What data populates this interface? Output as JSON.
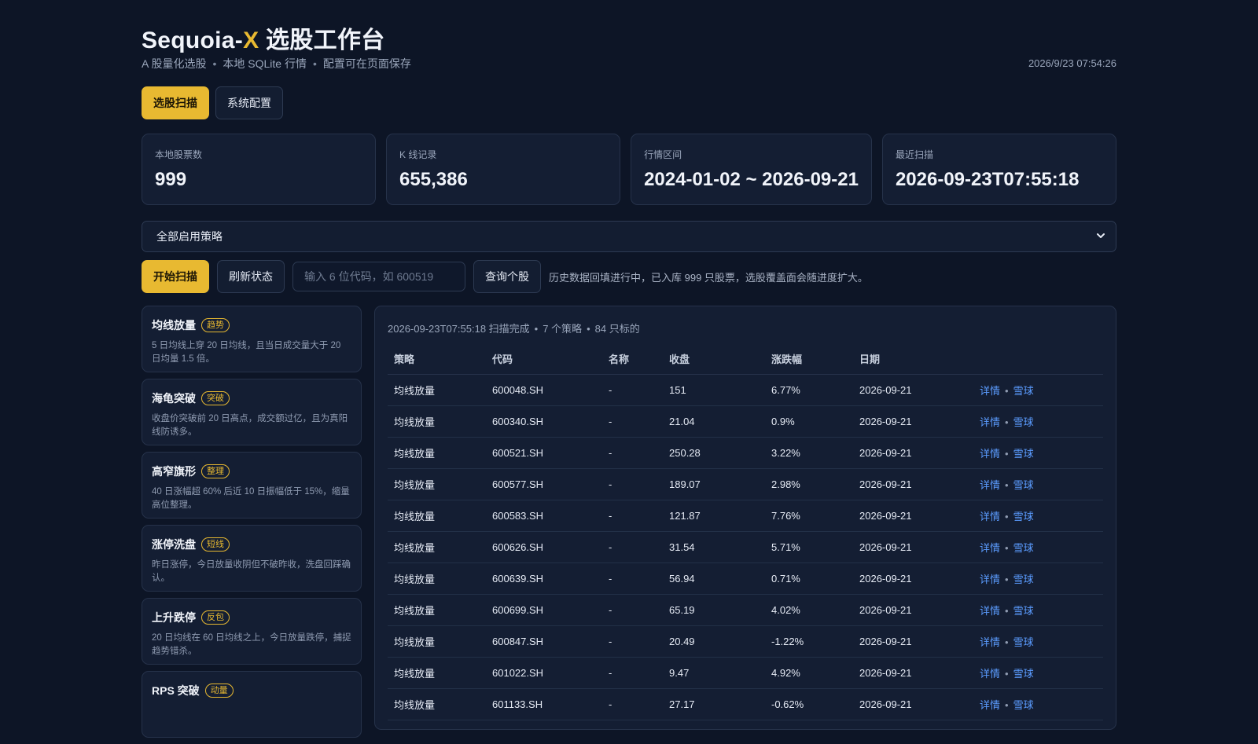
{
  "header": {
    "title_prefix": "Sequoia-",
    "title_accent": "X",
    "title_suffix": " 选股工作台",
    "subtitle_parts": [
      "A 股量化选股",
      "本地 SQLite 行情",
      "配置可在页面保存"
    ],
    "clock": "2026/9/23 07:54:26"
  },
  "tabs": [
    {
      "label": "选股扫描",
      "active": true
    },
    {
      "label": "系统配置",
      "active": false
    }
  ],
  "stats": [
    {
      "label": "本地股票数",
      "value": "999"
    },
    {
      "label": "K 线记录",
      "value": "655,386"
    },
    {
      "label": "行情区间",
      "value": "2024-01-02 ~ 2026-09-21"
    },
    {
      "label": "最近扫描",
      "value": "2026-09-23T07:55:18"
    }
  ],
  "strategy_select": {
    "value": "全部启用策略"
  },
  "actions": {
    "scan_label": "开始扫描",
    "refresh_label": "刷新状态",
    "code_placeholder": "输入 6 位代码，如 600519",
    "query_label": "查询个股",
    "hint": "历史数据回填进行中，已入库 999 只股票，选股覆盖面会随进度扩大。"
  },
  "strategies": [
    {
      "name": "均线放量",
      "tag": "趋势",
      "desc": "5 日均线上穿 20 日均线，且当日成交量大于 20 日均量 1.5 倍。"
    },
    {
      "name": "海龟突破",
      "tag": "突破",
      "desc": "收盘价突破前 20 日高点，成交额过亿，且为真阳线防诱多。"
    },
    {
      "name": "高窄旗形",
      "tag": "整理",
      "desc": "40 日涨幅超 60% 后近 10 日振幅低于 15%，缩量高位整理。"
    },
    {
      "name": "涨停洗盘",
      "tag": "短线",
      "desc": "昨日涨停，今日放量收阴但不破昨收，洗盘回踩确认。"
    },
    {
      "name": "上升跌停",
      "tag": "反包",
      "desc": "20 日均线在 60 日均线之上，今日放量跌停，捕捉趋势错杀。"
    },
    {
      "name": "RPS 突破",
      "tag": "动量",
      "desc": ""
    }
  ],
  "results": {
    "summary_parts": [
      "2026-09-23T07:55:18 扫描完成",
      "7 个策略",
      "84 只标的"
    ],
    "columns": [
      "策略",
      "代码",
      "名称",
      "收盘",
      "涨跌幅",
      "日期",
      ""
    ],
    "link_detail": "详情",
    "link_xueqiu": "雪球",
    "link_sep": "•",
    "rows": [
      {
        "strategy": "均线放量",
        "code": "600048.SH",
        "name": "-",
        "close": "151",
        "change": "6.77%",
        "dir": "up",
        "date": "2026-09-21"
      },
      {
        "strategy": "均线放量",
        "code": "600340.SH",
        "name": "-",
        "close": "21.04",
        "change": "0.9%",
        "dir": "up",
        "date": "2026-09-21"
      },
      {
        "strategy": "均线放量",
        "code": "600521.SH",
        "name": "-",
        "close": "250.28",
        "change": "3.22%",
        "dir": "up",
        "date": "2026-09-21"
      },
      {
        "strategy": "均线放量",
        "code": "600577.SH",
        "name": "-",
        "close": "189.07",
        "change": "2.98%",
        "dir": "up",
        "date": "2026-09-21"
      },
      {
        "strategy": "均线放量",
        "code": "600583.SH",
        "name": "-",
        "close": "121.87",
        "change": "7.76%",
        "dir": "up",
        "date": "2026-09-21"
      },
      {
        "strategy": "均线放量",
        "code": "600626.SH",
        "name": "-",
        "close": "31.54",
        "change": "5.71%",
        "dir": "up",
        "date": "2026-09-21"
      },
      {
        "strategy": "均线放量",
        "code": "600639.SH",
        "name": "-",
        "close": "56.94",
        "change": "0.71%",
        "dir": "up",
        "date": "2026-09-21"
      },
      {
        "strategy": "均线放量",
        "code": "600699.SH",
        "name": "-",
        "close": "65.19",
        "change": "4.02%",
        "dir": "up",
        "date": "2026-09-21"
      },
      {
        "strategy": "均线放量",
        "code": "600847.SH",
        "name": "-",
        "close": "20.49",
        "change": "-1.22%",
        "dir": "down",
        "date": "2026-09-21"
      },
      {
        "strategy": "均线放量",
        "code": "601022.SH",
        "name": "-",
        "close": "9.47",
        "change": "4.92%",
        "dir": "up",
        "date": "2026-09-21"
      },
      {
        "strategy": "均线放量",
        "code": "601133.SH",
        "name": "-",
        "close": "27.17",
        "change": "-0.62%",
        "dir": "down",
        "date": "2026-09-21"
      }
    ]
  },
  "colors": {
    "accent": "#e8b931",
    "up": "#f0585a",
    "down": "#27c46b",
    "link": "#5b9cff",
    "background": "#0d1526"
  }
}
